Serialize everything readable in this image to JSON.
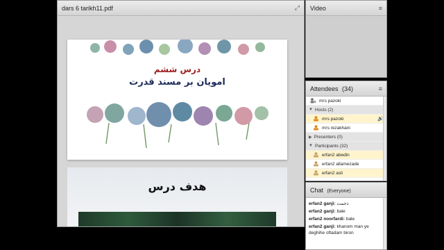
{
  "share": {
    "title": "dars 6 tarikh11.pdf",
    "slide1": {
      "line1": "درس ششم",
      "line2": "امویان بر مسند قدرت"
    },
    "slide2": {
      "title": "هدف درس"
    }
  },
  "video": {
    "title": "Video"
  },
  "attendees": {
    "title": "Attendees",
    "count": "(34)",
    "me": "mrs pazoki",
    "hosts_label": "Hosts (2)",
    "hosts": [
      "mrs pazoki",
      "mrs rezakhani"
    ],
    "presenters_label": "Presenters (0)",
    "participants_label": "Participants (32)",
    "participants": [
      "erfan2 abedin",
      "erfan2 allamezade",
      "erfan2 asli"
    ]
  },
  "chat": {
    "title": "Chat",
    "scope": "(Everyone)",
    "messages": [
      {
        "sender": "erfan2 ganji:",
        "text": "ذخمت"
      },
      {
        "sender": "erfan2 ganji:",
        "text": "bale"
      },
      {
        "sender": "erfan2 noorfardi:",
        "text": "bale"
      },
      {
        "sender": "erfan2 ganji:",
        "text": "khanom man ye deghihe oftadam biron"
      }
    ]
  },
  "colors": {
    "header_bg": "#d9d9d9",
    "slide_red": "#9b1c1c",
    "slide_navy": "#1c2b5a"
  }
}
